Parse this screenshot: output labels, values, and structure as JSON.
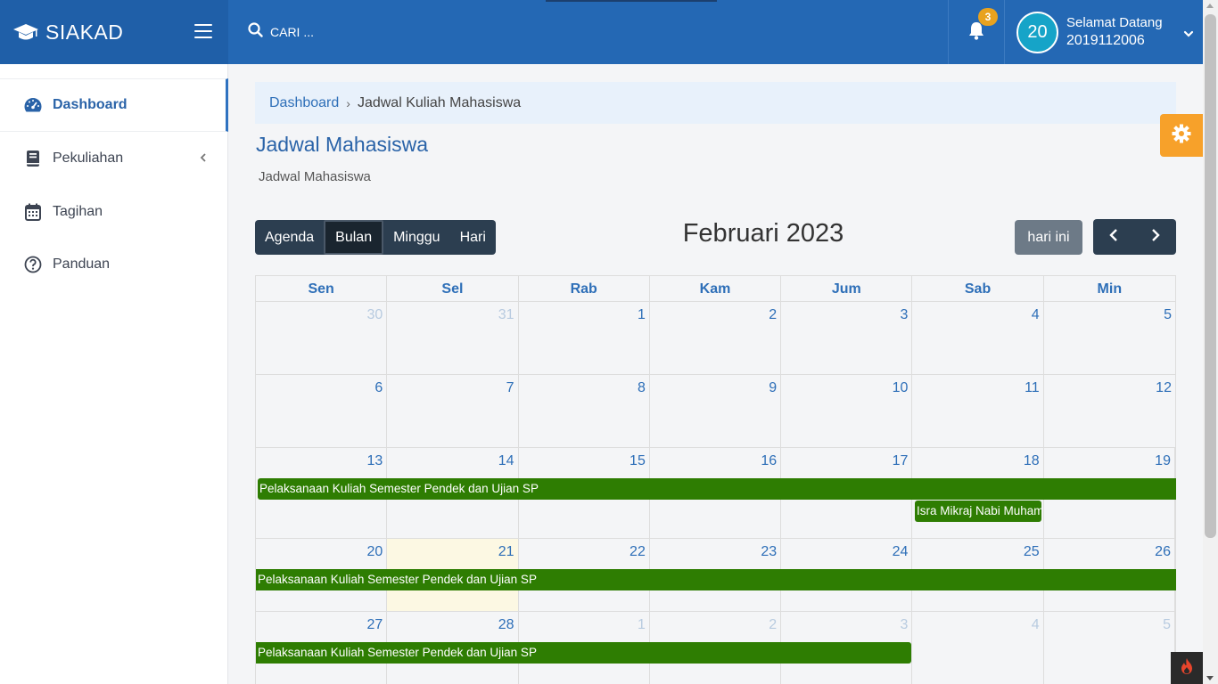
{
  "brand": {
    "name": "SIAKAD",
    "icon": "graduation-cap-icon"
  },
  "search": {
    "placeholder": "CARI ..."
  },
  "notifications": {
    "count": "3"
  },
  "user": {
    "avatar_text": "20",
    "greeting": "Selamat Datang",
    "id": "2019112006"
  },
  "sidebar": {
    "items": [
      {
        "label": "Dashboard",
        "icon": "dashboard-gauge-icon",
        "active": true
      },
      {
        "label": "Pekuliahan",
        "icon": "book-icon",
        "has_submenu": true
      },
      {
        "label": "Tagihan",
        "icon": "calendar-icon"
      },
      {
        "label": "Panduan",
        "icon": "question-circle-icon"
      }
    ]
  },
  "breadcrumb": {
    "root": "Dashboard",
    "separator": "›",
    "current": "Jadwal Kuliah Mahasiswa"
  },
  "page": {
    "title": "Jadwal Mahasiswa",
    "subtitle": "Jadwal Mahasiswa"
  },
  "calendar": {
    "views": [
      "Agenda",
      "Bulan",
      "Minggu",
      "Hari"
    ],
    "active_view": "Bulan",
    "title": "Februari 2023",
    "today_label": "hari ini",
    "weekdays": [
      "Sen",
      "Sel",
      "Rab",
      "Kam",
      "Jum",
      "Sab",
      "Min"
    ],
    "weeks": [
      [
        "30",
        "31",
        "1",
        "2",
        "3",
        "4",
        "5"
      ],
      [
        "6",
        "7",
        "8",
        "9",
        "10",
        "11",
        "12"
      ],
      [
        "13",
        "14",
        "15",
        "16",
        "17",
        "18",
        "19"
      ],
      [
        "20",
        "21",
        "22",
        "23",
        "24",
        "25",
        "26"
      ],
      [
        "27",
        "28",
        "1",
        "2",
        "3",
        "4",
        "5"
      ]
    ],
    "events": {
      "e1": "Pelaksanaan Kuliah Semester Pendek dan Ujian SP",
      "e2": "Isra Mikraj Nabi Muhammad",
      "e3": "Pelaksanaan Kuliah Semester Pendek dan Ujian SP",
      "e4": "Pelaksanaan Kuliah Semester Pendek dan Ujian SP"
    },
    "event_color": "#2e7d02",
    "today_color": "#fcf8e3"
  },
  "colors": {
    "topbar": "#2468b4",
    "brand_bg": "#1f5fa8",
    "settings": "#f7a12a",
    "notification_badge": "#e8a21f"
  }
}
